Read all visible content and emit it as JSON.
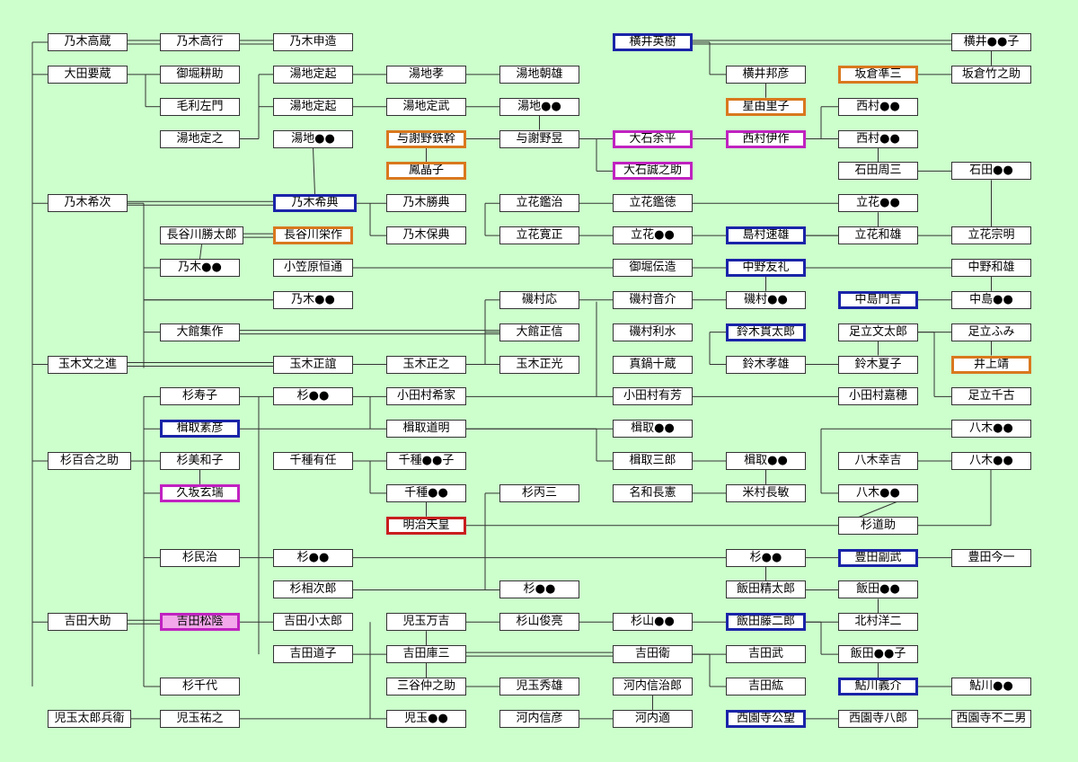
{
  "colors": {
    "background": "#ccffcc",
    "line": "#333333",
    "blue": "#1a24a8",
    "orange": "#d9781e",
    "purple": "#c022c0",
    "red": "#c81e1e",
    "pink": "#f2a8ea"
  },
  "persons": [
    {
      "id": "nogi_takakura",
      "name": "乃木高蔵"
    },
    {
      "id": "nogi_takayuki",
      "name": "乃木高行"
    },
    {
      "id": "nogi_nobuzo",
      "name": "乃木申造"
    },
    {
      "id": "ota_yozo",
      "name": "大田要蔵"
    },
    {
      "id": "mihori_kosuke",
      "name": "御堀耕助"
    },
    {
      "id": "mori_samon",
      "name": "毛利左門"
    },
    {
      "id": "yuchi_sadayuki",
      "name": "湯地定之"
    },
    {
      "id": "yuchi_sadamoto",
      "name": "湯地定起"
    },
    {
      "id": "yuchi_sadamoto2",
      "name": "湯地定起"
    },
    {
      "id": "yuchi_x",
      "name": "湯地●●"
    },
    {
      "id": "yuchi_takashi",
      "name": "湯地孝"
    },
    {
      "id": "yuchi_sadatake",
      "name": "湯地定武"
    },
    {
      "id": "yuchi_asao",
      "name": "湯地朝雄"
    },
    {
      "id": "yuchi_y",
      "name": "湯地●●"
    },
    {
      "id": "yosano_tekkan",
      "name": "与謝野鉄幹",
      "highlight": "orange"
    },
    {
      "id": "yosano_akiko",
      "name": "鳳晶子",
      "highlight": "orange"
    },
    {
      "id": "yosano_noboru",
      "name": "与謝野昱"
    },
    {
      "id": "nogi_maresuke",
      "name": "乃木希次"
    },
    {
      "id": "nogi_maretsune",
      "name": "乃木希典",
      "highlight": "blue"
    },
    {
      "id": "nogi_katsunori",
      "name": "乃木勝典"
    },
    {
      "id": "nogi_yasunori",
      "name": "乃木保典"
    },
    {
      "id": "hasegawa_katsutaro",
      "name": "長谷川勝太郎"
    },
    {
      "id": "hasegawa_eisaku",
      "name": "長谷川栄作",
      "highlight": "orange"
    },
    {
      "id": "nogi_a",
      "name": "乃木●●"
    },
    {
      "id": "ogasawara",
      "name": "小笠原恒通"
    },
    {
      "id": "nogi_b",
      "name": "乃木●●"
    },
    {
      "id": "tachibana_kanji",
      "name": "立花鑑治"
    },
    {
      "id": "tachibana_kantoku",
      "name": "立花鑑徳"
    },
    {
      "id": "tachibana_kansei",
      "name": "立花寛正"
    },
    {
      "id": "tachibana_x",
      "name": "立花●●"
    },
    {
      "id": "mihori_nobumichi",
      "name": "御堀伝造"
    },
    {
      "id": "isomura_o",
      "name": "磯村応"
    },
    {
      "id": "isomura_otosuke",
      "name": "磯村音介"
    },
    {
      "id": "isomura_x",
      "name": "磯村●●"
    },
    {
      "id": "isomura_risui",
      "name": "磯村利水"
    },
    {
      "id": "manabe",
      "name": "真鍋十蔵"
    },
    {
      "id": "odate_shusaku",
      "name": "大館集作"
    },
    {
      "id": "odate_masanobu",
      "name": "大館正信"
    },
    {
      "id": "tamaki_bunnoshin",
      "name": "玉木文之進"
    },
    {
      "id": "tamaki_masayoshi",
      "name": "玉木正誼"
    },
    {
      "id": "tamaki_masayuki",
      "name": "玉木正之"
    },
    {
      "id": "tamaki_masamitsu",
      "name": "玉木正光"
    },
    {
      "id": "sugi_hisako",
      "name": "杉寿子"
    },
    {
      "id": "sugi_x1",
      "name": "杉●●"
    },
    {
      "id": "odamura_kiyoie",
      "name": "小田村希家"
    },
    {
      "id": "odamura_ariyoshi",
      "name": "小田村有芳"
    },
    {
      "id": "odamura_yoshiho",
      "name": "小田村嘉穂"
    },
    {
      "id": "katori_motohiko",
      "name": "楫取素彦",
      "highlight": "blue"
    },
    {
      "id": "katori_michiaki",
      "name": "楫取道明"
    },
    {
      "id": "katori_x1",
      "name": "楫取●●"
    },
    {
      "id": "sugi_yurinosuke",
      "name": "杉百合之助"
    },
    {
      "id": "sugi_miwako",
      "name": "杉美和子"
    },
    {
      "id": "chigusa_aritou",
      "name": "千種有任"
    },
    {
      "id": "chigusa_x1",
      "name": "千種●●子"
    },
    {
      "id": "katori_saburo",
      "name": "楫取三郎"
    },
    {
      "id": "katori_x2",
      "name": "楫取●●"
    },
    {
      "id": "kusaka_genzui",
      "name": "久坂玄瑞",
      "highlight": "purple"
    },
    {
      "id": "chigusa_x2",
      "name": "千種●●"
    },
    {
      "id": "sugi_heizo",
      "name": "杉丙三"
    },
    {
      "id": "nawa_nagatoshi",
      "name": "名和長憲"
    },
    {
      "id": "yonemura",
      "name": "米村長敏"
    },
    {
      "id": "meiji",
      "name": "明治天皇",
      "highlight": "red"
    },
    {
      "id": "sugi_michisuke",
      "name": "杉道助"
    },
    {
      "id": "sugi_tamiji",
      "name": "杉民治"
    },
    {
      "id": "sugi_x2",
      "name": "杉●●"
    },
    {
      "id": "sugi_aijiro",
      "name": "杉相次郎"
    },
    {
      "id": "sugi_x3",
      "name": "杉●●"
    },
    {
      "id": "sugi_x4",
      "name": "杉●●"
    },
    {
      "id": "iida_seitaro",
      "name": "飯田精太郎"
    },
    {
      "id": "yoshida_daisuke",
      "name": "吉田大助"
    },
    {
      "id": "yoshida_shoin",
      "name": "吉田松陰",
      "highlight": "purple",
      "fill": "pink"
    },
    {
      "id": "yoshida_kotaro",
      "name": "吉田小太郎"
    },
    {
      "id": "kodama_mankichi",
      "name": "児玉万吉"
    },
    {
      "id": "sugiyama_toshiaki",
      "name": "杉山俊亮"
    },
    {
      "id": "sugiyama_x",
      "name": "杉山●●"
    },
    {
      "id": "yoshida_michiko",
      "name": "吉田道子"
    },
    {
      "id": "yoshida_kozo",
      "name": "吉田庫三"
    },
    {
      "id": "yoshida_mamoru",
      "name": "吉田衛"
    },
    {
      "id": "yoshida_takeshi",
      "name": "吉田武"
    },
    {
      "id": "yoshida_hiroshi",
      "name": "吉田紘"
    },
    {
      "id": "mitani",
      "name": "三谷仲之助"
    },
    {
      "id": "kodama_hideo",
      "name": "児玉秀雄"
    },
    {
      "id": "kochi_shinjiro",
      "name": "河内信治郎"
    },
    {
      "id": "sugi_chiyo",
      "name": "杉千代"
    },
    {
      "id": "kodama_taro",
      "name": "児玉太郎兵衛"
    },
    {
      "id": "kodama_sukeyuki",
      "name": "児玉祐之"
    },
    {
      "id": "kodama_x",
      "name": "児玉●●"
    },
    {
      "id": "kochi_nobuhiko",
      "name": "河内信彦"
    },
    {
      "id": "kochi_tekishi",
      "name": "河内適"
    },
    {
      "id": "yokoi_eiju",
      "name": "横井英樹",
      "highlight": "blue"
    },
    {
      "id": "yokoi_kunihiko",
      "name": "横井邦彦"
    },
    {
      "id": "yokoi_x",
      "name": "横井●●子"
    },
    {
      "id": "sakakura_junzo",
      "name": "坂倉準三",
      "highlight": "orange"
    },
    {
      "id": "sakakura_takenosuke",
      "name": "坂倉竹之助"
    },
    {
      "id": "hoshi_yuriko",
      "name": "星由里子",
      "highlight": "orange"
    },
    {
      "id": "nishimura_x1",
      "name": "西村●●"
    },
    {
      "id": "oishi_yohei",
      "name": "大石余平",
      "highlight": "purple"
    },
    {
      "id": "nishimura_isaku",
      "name": "西村伊作",
      "highlight": "purple"
    },
    {
      "id": "nishimura_x2",
      "name": "西村●●"
    },
    {
      "id": "oishi_seinosuke",
      "name": "大石誠之助",
      "highlight": "purple"
    },
    {
      "id": "ishida_shuzo",
      "name": "石田周三"
    },
    {
      "id": "ishida_x",
      "name": "石田●●"
    },
    {
      "id": "tachibana_y",
      "name": "立花●●"
    },
    {
      "id": "shimamura_hayao",
      "name": "島村速雄",
      "highlight": "blue"
    },
    {
      "id": "tachibana_kazuo",
      "name": "立花和雄"
    },
    {
      "id": "tachibana_muneaki",
      "name": "立花宗明"
    },
    {
      "id": "nakano_tomonori",
      "name": "中野友礼",
      "highlight": "blue"
    },
    {
      "id": "nakano_kazuo",
      "name": "中野和雄"
    },
    {
      "id": "nakajima_monkichi",
      "name": "中島門吉",
      "highlight": "blue"
    },
    {
      "id": "nakajima_x",
      "name": "中島●●"
    },
    {
      "id": "suzuki_kantaro",
      "name": "鈴木貫太郎",
      "highlight": "blue"
    },
    {
      "id": "adachi_buntaro",
      "name": "足立文太郎"
    },
    {
      "id": "adachi_fumi",
      "name": "足立ふみ"
    },
    {
      "id": "inoue_yasushi",
      "name": "井上靖",
      "highlight": "orange"
    },
    {
      "id": "suzuki_takao",
      "name": "鈴木孝雄"
    },
    {
      "id": "suzuki_natsuko",
      "name": "鈴木夏子"
    },
    {
      "id": "adachi_chikako",
      "name": "足立千古"
    },
    {
      "id": "yagi_x1",
      "name": "八木●●"
    },
    {
      "id": "yagi_kokichi",
      "name": "八木幸吉"
    },
    {
      "id": "yagi_x2",
      "name": "八木●●"
    },
    {
      "id": "yagi_x3",
      "name": "八木●●"
    },
    {
      "id": "toyoda_soemu",
      "name": "豊田副武",
      "highlight": "blue"
    },
    {
      "id": "toyoda_konichi",
      "name": "豊田今一"
    },
    {
      "id": "iida_x1",
      "name": "飯田●●"
    },
    {
      "id": "iida_tojiro",
      "name": "飯田藤二郎",
      "highlight": "blue"
    },
    {
      "id": "kitamura_yoji",
      "name": "北村洋二"
    },
    {
      "id": "iida_x2",
      "name": "飯田●●子"
    },
    {
      "id": "ayukawa_yoshisuke",
      "name": "鮎川義介",
      "highlight": "blue"
    },
    {
      "id": "ayukawa_x",
      "name": "鮎川●●"
    },
    {
      "id": "saionji_kinmochi",
      "name": "西園寺公望",
      "highlight": "blue"
    },
    {
      "id": "saionji_hachiro",
      "name": "西園寺八郎"
    },
    {
      "id": "saionji_fujio",
      "name": "西園寺不二男"
    }
  ]
}
